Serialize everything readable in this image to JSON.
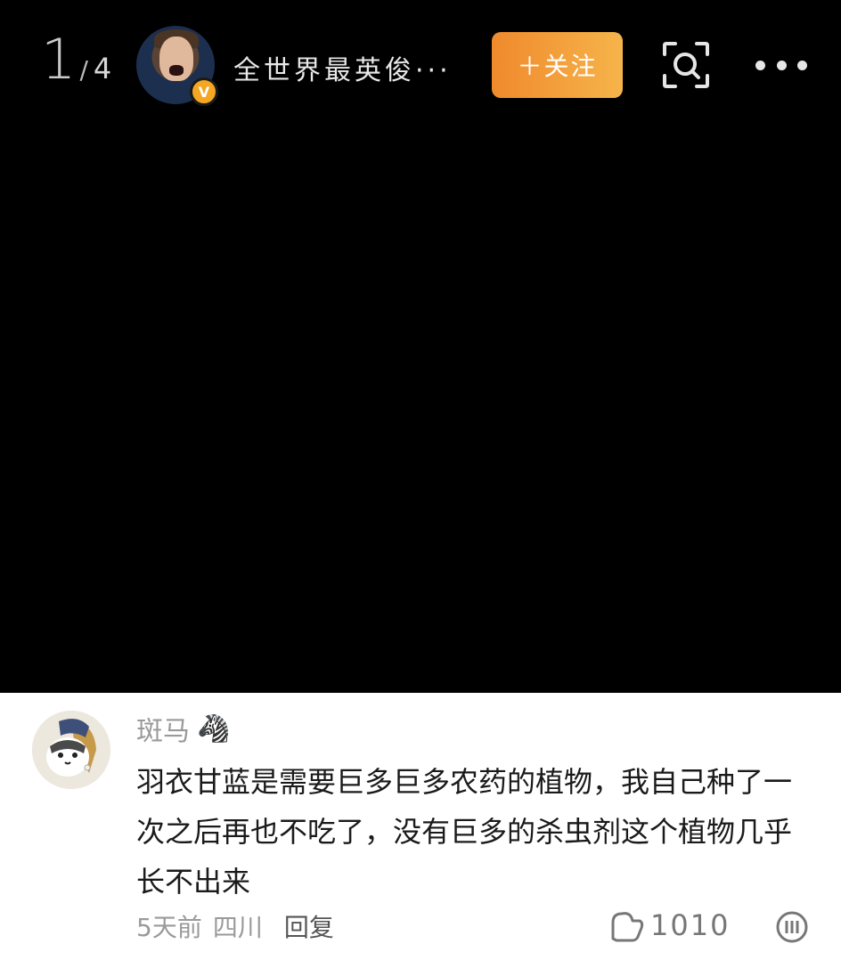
{
  "viewer": {
    "page_current": "1",
    "page_separator": "/",
    "page_total": "4"
  },
  "header": {
    "username": "全世界最英俊···",
    "verified_badge": "V",
    "follow_label": "＋关注"
  },
  "comment": {
    "author": "斑马",
    "author_emoji": "🦓",
    "text": "羽衣甘蓝是需要巨多巨多农药的植物，我自己种了一次之后再也不吃了，没有巨多的杀虫剂这个植物几乎长不出来",
    "time": "5天前",
    "location": "四川",
    "reply_label": "回复",
    "like_count": "1010"
  },
  "icons": {
    "scan": "scan-icon",
    "more": "more-icon",
    "like": "like-icon",
    "comment_more": "comment-more-icon"
  },
  "colors": {
    "follow_gradient_start": "#f08a2c",
    "follow_gradient_end": "#f6b44b",
    "badge": "#f5a623"
  }
}
